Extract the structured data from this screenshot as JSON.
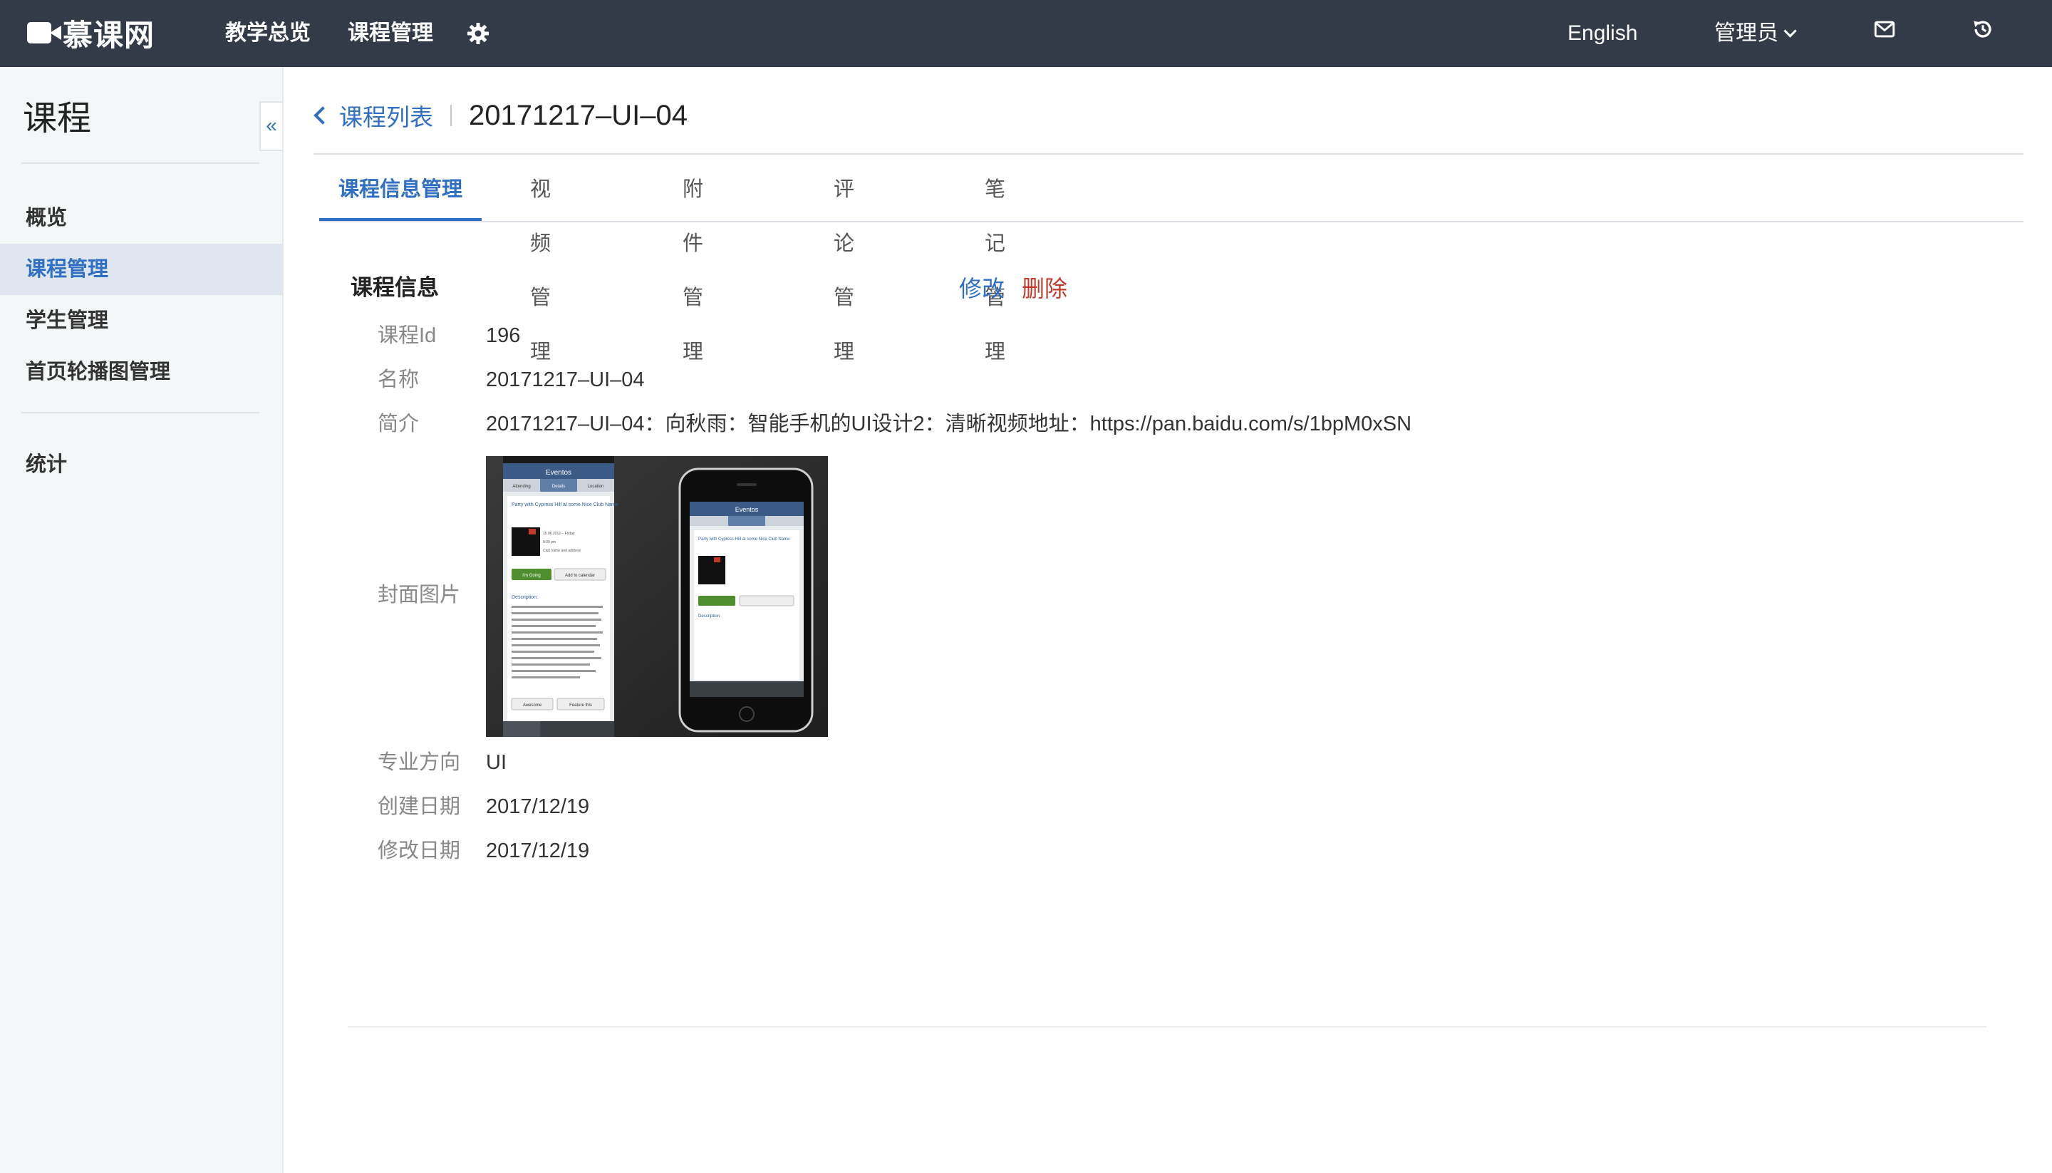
{
  "brand": {
    "name": "慕课网"
  },
  "nav": {
    "overview": "教学总览",
    "course_mgmt": "课程管理",
    "settings_icon": "gear-icon"
  },
  "topright": {
    "language": "English",
    "user": "管理员",
    "mail_icon": "mail-icon",
    "history_icon": "history-icon"
  },
  "sidebar": {
    "title": "课程",
    "items": [
      {
        "label": "概览"
      },
      {
        "label": "课程管理"
      },
      {
        "label": "学生管理"
      },
      {
        "label": "首页轮播图管理"
      },
      {
        "label": "统计"
      }
    ],
    "active_index": 1,
    "collapse_icon": "«"
  },
  "breadcrumb": {
    "back_label": "课程列表",
    "title": "20171217–UI–04"
  },
  "tabs": [
    {
      "label": "课程信息管理"
    },
    {
      "label": "视频管理"
    },
    {
      "label": "附件管理"
    },
    {
      "label": "评论管理"
    },
    {
      "label": "笔记管理"
    }
  ],
  "active_tab": 0,
  "section": {
    "title": "课程信息",
    "edit_label": "修改",
    "delete_label": "删除"
  },
  "info": {
    "id": {
      "label": "课程Id",
      "value": "196"
    },
    "name": {
      "label": "名称",
      "value": "20171217–UI–04"
    },
    "intro": {
      "label": "简介",
      "value": "20171217–UI–04：向秋雨：智能手机的UI设计2：清晰视频地址：https://pan.baidu.com/s/1bpM0xSN"
    },
    "cover": {
      "label": "封面图片"
    },
    "major": {
      "label": "专业方向",
      "value": "UI"
    },
    "created": {
      "label": "创建日期",
      "value": "2017/12/19"
    },
    "updated": {
      "label": "修改日期",
      "value": "2017/12/19"
    }
  },
  "cover_image": {
    "app_title": "Eventos",
    "tabs": [
      "Attending",
      "Details",
      "Location"
    ],
    "event_title": "Party with Cypress Hill at some Nice Club Name",
    "date": "15.06.2012 – Friday",
    "time": "8:00 pm",
    "venue": "Club name and address",
    "btn_going": "I'm Going",
    "btn_calendar": "Add to calendar",
    "desc_heading": "Description:",
    "desc_text": "Lorem Ipsum is simply dummy text of the printing and typesetting industry. Lorem Ipsum has been the industry's standard dummy text ever since the 1500s, when an unknown printer took a galley of type and scrambled it to make a type specimen book. It has survived not only five centuries, but also the leap into electronic typesetting, remaining essentially unchanged. Typesetting, remaining essentially unchanged.",
    "btn_awesome": "Awesome",
    "btn_feature": "Feature this"
  },
  "colors": {
    "topbar_bg": "#333b48",
    "accent": "#2f6fc4",
    "danger": "#c0392b",
    "sidebar_bg": "#f4f7f8",
    "sidebar_active_bg": "#dfe6ef"
  }
}
